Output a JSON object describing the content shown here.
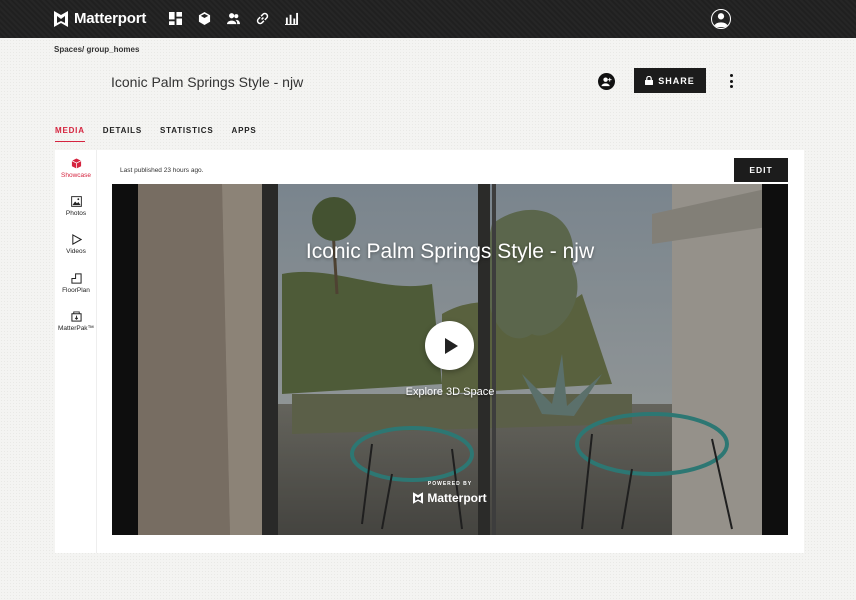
{
  "topbar": {
    "brand": "Matterport",
    "nav_icons": [
      "dashboard-icon",
      "cube-icon",
      "users-icon",
      "link-icon",
      "analytics-icon"
    ]
  },
  "breadcrumb": {
    "root": "Spaces",
    "separator": "/",
    "current": "group_homes"
  },
  "header": {
    "title": "Iconic Palm Springs Style - njw",
    "share_label": "SHARE"
  },
  "tabs": [
    {
      "label": "MEDIA",
      "active": true
    },
    {
      "label": "DETAILS",
      "active": false
    },
    {
      "label": "STATISTICS",
      "active": false
    },
    {
      "label": "APPS",
      "active": false
    }
  ],
  "sidebar": {
    "items": [
      {
        "label": "Showcase",
        "icon": "cube-icon",
        "active": true
      },
      {
        "label": "Photos",
        "icon": "image-icon",
        "active": false
      },
      {
        "label": "Videos",
        "icon": "play-icon",
        "active": false
      },
      {
        "label": "FloorPlan",
        "icon": "floorplan-icon",
        "active": false
      },
      {
        "label": "MatterPak™",
        "icon": "package-icon",
        "active": false
      }
    ]
  },
  "panel": {
    "published": "Last published 23 hours ago.",
    "edit_label": "EDIT"
  },
  "player": {
    "title": "Iconic Palm Springs Style - njw",
    "explore_label": "Explore 3D Space",
    "powered_by": "POWERED BY",
    "brand": "Matterport"
  },
  "colors": {
    "accent": "#d5243f",
    "topbar": "#232323",
    "button": "#1c1c1c"
  }
}
